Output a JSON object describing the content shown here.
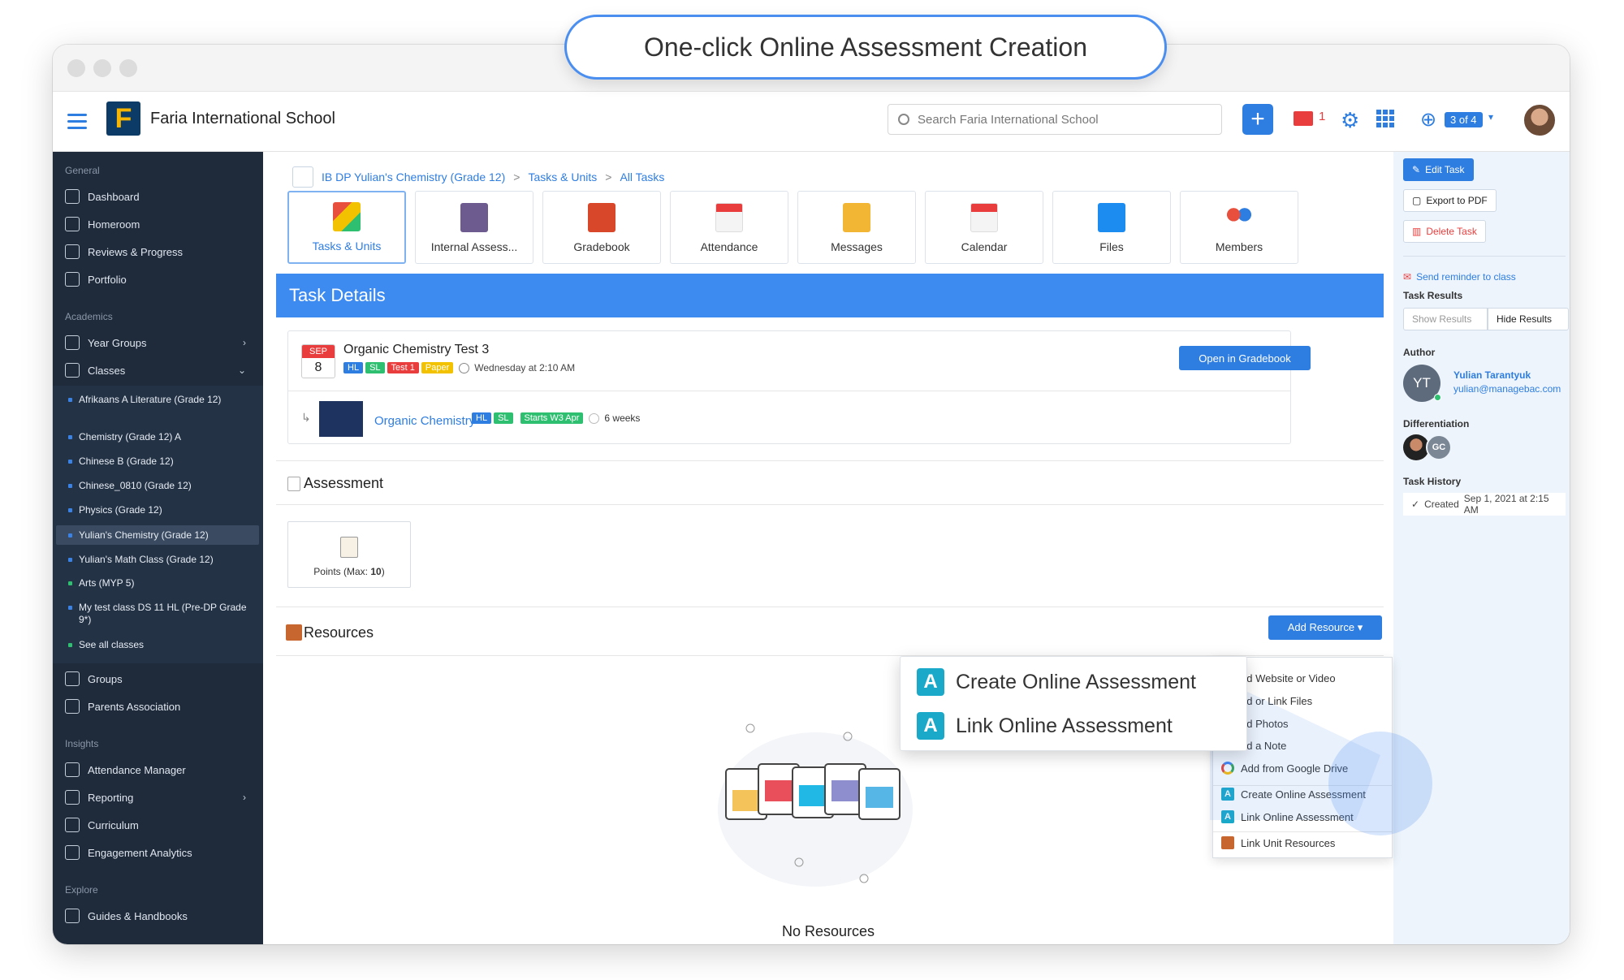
{
  "banner": {
    "title": "One-click Online Assessment Creation"
  },
  "header": {
    "school": "Faria International School",
    "logo_letter": "F",
    "search_placeholder": "Search Faria International School",
    "plus_label": "+",
    "mail_count": "1",
    "page_counter": "3 of 4",
    "caret": "▾",
    "gear_icon": "⚙",
    "help_icon": "⊕"
  },
  "sidebar": {
    "general_label": "General",
    "general": [
      "Dashboard",
      "Homeroom",
      "Reviews & Progress",
      "Portfolio"
    ],
    "academics_label": "Academics",
    "year_groups": "Year Groups",
    "classes": "Classes",
    "class_list": [
      "Afrikaans A Literature (Grade 12)",
      "Chemistry (Grade 12) A",
      "Chinese B (Grade 12)",
      "Chinese_0810 (Grade 12)",
      "Physics (Grade 12)",
      "Yulian's Chemistry (Grade 12)",
      "Yulian's Math Class (Grade 12)",
      "Arts (MYP 5)",
      "My test class DS 11 HL (Pre-DP Grade 9*)"
    ],
    "see_all": "See all classes",
    "groups": "Groups",
    "parents": "Parents Association",
    "insights_label": "Insights",
    "insights": [
      "Attendance Manager",
      "Reporting",
      "Curriculum",
      "Engagement Analytics"
    ],
    "explore_label": "Explore",
    "explore": [
      "Guides & Handbooks"
    ],
    "chev_right": "›",
    "chev_down": "⌄"
  },
  "breadcrumb": {
    "class": "IB DP Yulian's Chemistry (Grade 12)",
    "section": "Tasks & Units",
    "page": "All Tasks",
    "sep": ">"
  },
  "tabs": [
    "Tasks & Units",
    "Internal Assess...",
    "Gradebook",
    "Attendance",
    "Messages",
    "Calendar",
    "Files",
    "Members"
  ],
  "task": {
    "header": "Task Details",
    "month": "SEP",
    "day": "8",
    "title": "Organic Chemistry Test 3",
    "tags": [
      "HL",
      "SL",
      "Test 1",
      "Paper"
    ],
    "datetime": "Wednesday at 2:10 AM",
    "gradebook_btn": "Open in Gradebook",
    "unit": "Organic Chemistry",
    "unit_tags": [
      "HL",
      "SL",
      "Starts W3 Apr"
    ],
    "weeks": "6 weeks"
  },
  "assessment": {
    "label": "Assessment",
    "points_label": "Points (Max: ",
    "points_max": "10",
    "points_close": ")"
  },
  "resources": {
    "label": "Resources",
    "add_btn": "Add Resource ▾",
    "empty": "No Resources",
    "dropdown": [
      "dd Website or Video",
      "dd or Link Files",
      "dd Photos",
      "dd a Note",
      "Add from Google Drive",
      "Create Online Assessment",
      "Link Online Assessment",
      "Link Unit Resources"
    ],
    "zoom": [
      "Create Online Assessment",
      "Link Online Assessment"
    ],
    "a_letter": "A"
  },
  "right": {
    "edit": "Edit Task",
    "export": "Export to PDF",
    "delete": "Delete Task",
    "reminder": "Send reminder to class",
    "results_label": "Task Results",
    "show": "Show Results",
    "hide": "Hide Results",
    "author_label": "Author",
    "author_initials": "YT",
    "author_name": "Yulian Tarantyuk",
    "author_email": "yulian@managebac.com",
    "diff_label": "Differentiation",
    "diff_initials": "GC",
    "history_label": "Task History",
    "created_prefix": "Created",
    "created": "Sep 1, 2021 at 2:15 AM"
  },
  "help_fab": "?",
  "colors": {
    "accent": "#2e7de1",
    "sidebar": "#1f2b3b",
    "red": "#e93d3d",
    "green": "#2fbf71",
    "yellow": "#f2c200"
  }
}
